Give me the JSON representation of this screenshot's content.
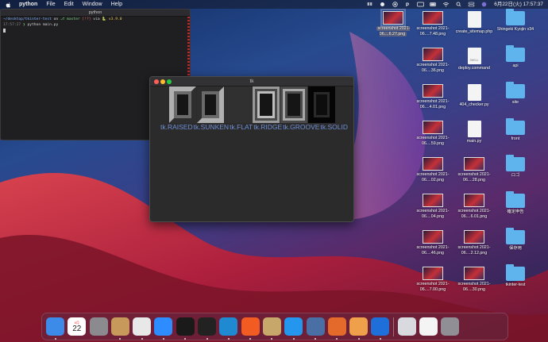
{
  "menubar": {
    "app_name": "python",
    "items": [
      "File",
      "Edit",
      "Window",
      "Help"
    ],
    "clock": "6月22日(火) 17:57:37"
  },
  "terminal": {
    "title": "python",
    "prompt_path": "~/desktop/tkinter-test",
    "prompt_on": "on",
    "git_branch": "master",
    "git_status": "[!?]",
    "prompt_via": "via",
    "python_version": "v3.9.0",
    "prompt_time": "17:57:27",
    "command": "python main.py"
  },
  "tk_window": {
    "title": "tk",
    "relief_labels": [
      "tk.RAISED",
      "tk.SUNKEN",
      "tk.FLAT",
      "tk.RIDGE",
      "tk.GROOVE",
      "tk.SOLID"
    ]
  },
  "desktop_icons": [
    {
      "label": "screenshot 2021-06....6.27.png",
      "type": "thumb",
      "selected": true
    },
    {
      "label": "screenshot 2021-06....7.48.png",
      "type": "thumb"
    },
    {
      "label": "create_sitemap.php",
      "type": "doc"
    },
    {
      "label": "Shingeki Kyojin v34",
      "type": "folder"
    },
    {
      "label": "screenshot 2021-06....36.png",
      "type": "thumb"
    },
    {
      "label": "deploy.command",
      "type": "doc",
      "tag": "SHELL"
    },
    {
      "label": "api",
      "type": "folder"
    },
    {
      "label": "screenshot 2021-06....4.01.png",
      "type": "thumb"
    },
    {
      "label": "404_checker.py",
      "type": "doc"
    },
    {
      "label": "site",
      "type": "folder"
    },
    {
      "label": "screenshot 2021-06....59.png",
      "type": "thumb"
    },
    {
      "label": "main.py",
      "type": "doc"
    },
    {
      "label": "front",
      "type": "folder"
    },
    {
      "label": "screenshot 2021-06....02.png",
      "type": "thumb"
    },
    {
      "label": "screenshot 2021-06....28.png",
      "type": "thumb"
    },
    {
      "label": "ロゴ",
      "type": "folder"
    },
    {
      "label": "screenshot 2021-06....04.png",
      "type": "thumb"
    },
    {
      "label": "screenshot 2021-06....6.01.png",
      "type": "thumb"
    },
    {
      "label": "確定申告",
      "type": "folder"
    },
    {
      "label": "screenshot 2021-06....46.png",
      "type": "thumb"
    },
    {
      "label": "screenshot 2021-06....2.12.png",
      "type": "thumb"
    },
    {
      "label": "保存用",
      "type": "folder"
    },
    {
      "label": "screenshot 2021-06....7.00.png",
      "type": "thumb"
    },
    {
      "label": "screenshot 2021-06....30.png",
      "type": "thumb"
    },
    {
      "label": "tkinter-test",
      "type": "folder"
    }
  ],
  "dock": {
    "calendar_month": "6月",
    "calendar_day": "22",
    "apps": [
      {
        "name": "finder-icon",
        "color": "#3d8be8"
      },
      {
        "name": "calendar-icon",
        "color": "#ffffff"
      },
      {
        "name": "system-preferences-icon",
        "color": "#8a8a8f"
      },
      {
        "name": "contacts-icon",
        "color": "#c79a5b"
      },
      {
        "name": "chrome-icon",
        "color": "#e8e8e8"
      },
      {
        "name": "zoom-icon",
        "color": "#2d8cff"
      },
      {
        "name": "activity-monitor-icon",
        "color": "#1a1a1a"
      },
      {
        "name": "terminal-icon",
        "color": "#222222"
      },
      {
        "name": "vscode-icon",
        "color": "#1f8ad2"
      },
      {
        "name": "analytics-icon",
        "color": "#f25c22"
      },
      {
        "name": "python-launcher-icon",
        "color": "#c8a86a"
      },
      {
        "name": "docker-icon",
        "color": "#2496ed"
      },
      {
        "name": "quicktime-icon",
        "color": "#4a6fa5"
      },
      {
        "name": "git-client-icon",
        "color": "#e36a2a"
      },
      {
        "name": "sketch-icon",
        "color": "#f0a04b"
      },
      {
        "name": "infinity-app-icon",
        "color": "#1e6fd9"
      }
    ],
    "trailing": [
      {
        "name": "preview-icon",
        "color": "#d9d9e0"
      },
      {
        "name": "document-icon",
        "color": "#f4f4f4"
      },
      {
        "name": "trash-icon",
        "color": "#8f8f95"
      }
    ]
  },
  "colors": {
    "tk_label_blue": "#6f8fd8",
    "terminal_bg": "#1f1f22",
    "folder_blue": "#5fb4ee"
  }
}
